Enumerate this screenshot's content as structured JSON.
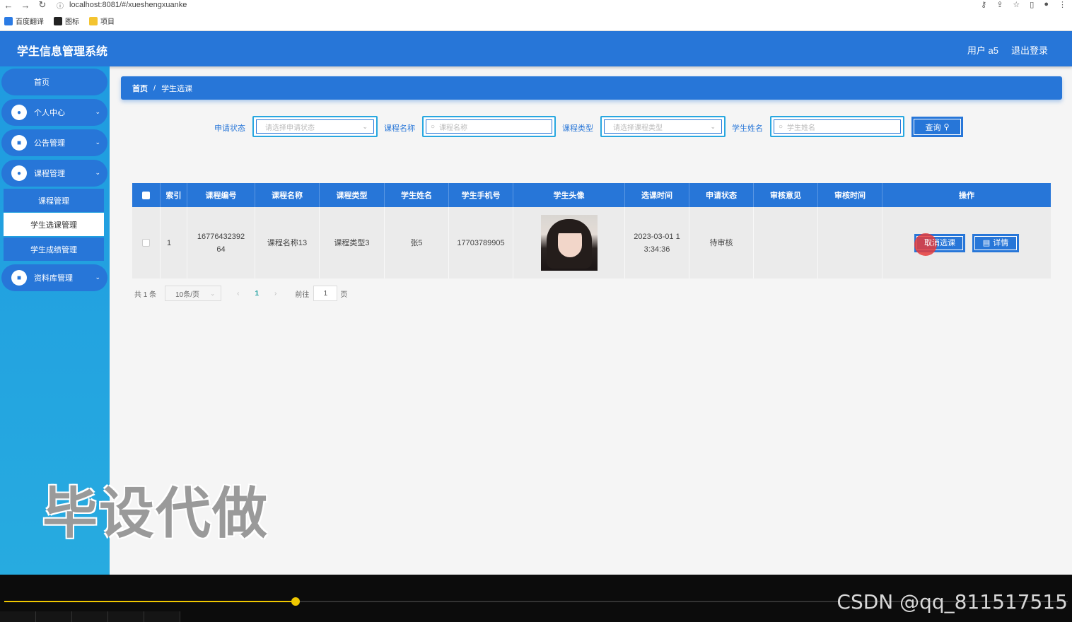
{
  "browser": {
    "url": "localhost:8081/#/xueshengxuanke",
    "bookmarks": [
      {
        "label": "百度翻译",
        "color": "#2b7be4"
      },
      {
        "label": "图标",
        "color": "#222222"
      },
      {
        "label": "项目",
        "color": "#f4c430"
      }
    ]
  },
  "header": {
    "app_title": "学生信息管理系统",
    "user_label": "用户 a5",
    "logout_label": "退出登录"
  },
  "sidebar": {
    "home": "首页",
    "groups": [
      {
        "label": "个人中心"
      },
      {
        "label": "公告管理"
      },
      {
        "label": "课程管理"
      }
    ],
    "sub_items": [
      {
        "label": "课程管理"
      },
      {
        "label": "学生选课管理"
      },
      {
        "label": "学生成绩管理"
      }
    ],
    "last_group": "资料库管理",
    "watermark": "毕设代做"
  },
  "breadcrumb": {
    "home": "首页",
    "separator": "/",
    "current": "学生选课"
  },
  "search": {
    "status_label": "申请状态",
    "status_placeholder": "请选择申请状态",
    "course_name_label": "课程名称",
    "course_name_placeholder": "课程名称",
    "course_type_label": "课程类型",
    "course_type_placeholder": "请选择课程类型",
    "student_name_label": "学生姓名",
    "student_name_placeholder": "学生姓名",
    "query_button": "查询"
  },
  "table": {
    "columns": [
      "索引",
      "课程编号",
      "课程名称",
      "课程类型",
      "学生姓名",
      "学生手机号",
      "学生头像",
      "选课时间",
      "申请状态",
      "审核意见",
      "审核时间",
      "操作"
    ],
    "rows": [
      {
        "index": "1",
        "course_no_line1": "16776432392",
        "course_no_line2": "64",
        "course_name": "课程名称13",
        "course_type": "课程类型3",
        "student_name": "张5",
        "phone": "17703789905",
        "time_line1": "2023-03-01 1",
        "time_line2": "3:34:36",
        "status": "待审核",
        "review_opinion": "",
        "review_time": "",
        "cancel_button": "取消选课",
        "detail_button": "详情"
      }
    ]
  },
  "pagination": {
    "total": "共 1 条",
    "page_size": "10条/页",
    "current_page": "1",
    "goto_label": "前往",
    "goto_value": "1",
    "page_unit": "页"
  },
  "video": {
    "progress": 0.274,
    "watermark": "CSDN @qq_811517515"
  },
  "colors": {
    "primary": "#2776d8",
    "sidebar": "#1f9be0",
    "accent_border": "#27a7e0"
  }
}
